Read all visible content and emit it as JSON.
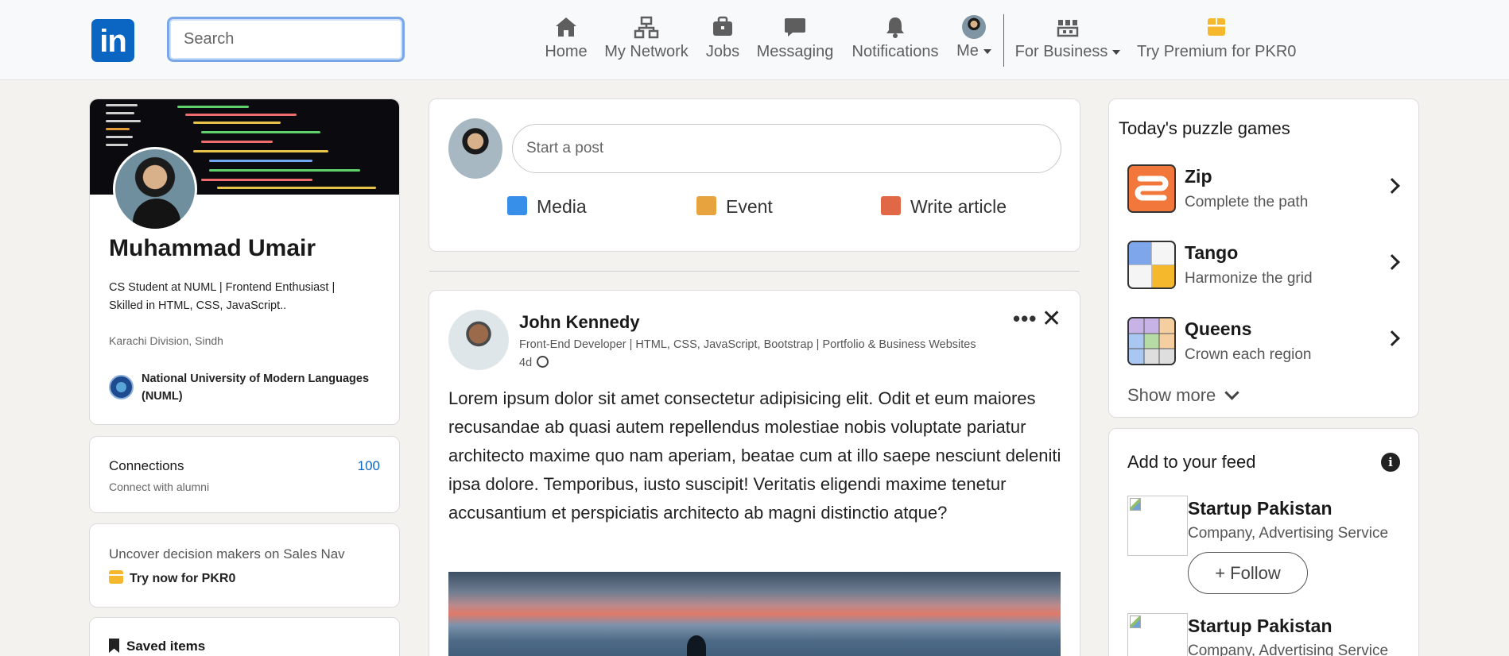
{
  "header": {
    "logo_text": "in",
    "search_placeholder": "Search",
    "nav": [
      {
        "label": "Home",
        "icon": "home-icon"
      },
      {
        "label": "My Network",
        "icon": "network-icon"
      },
      {
        "label": "Jobs",
        "icon": "briefcase-icon"
      },
      {
        "label": "Messaging",
        "icon": "message-icon"
      },
      {
        "label": "Notifications",
        "icon": "bell-icon"
      },
      {
        "label": "Me",
        "icon": "avatar-icon"
      },
      {
        "label": "For Business",
        "icon": "apps-grid-icon"
      },
      {
        "label": "Try Premium for PKR0",
        "icon": "premium-icon"
      }
    ]
  },
  "profile": {
    "name": "Muhammad Umair",
    "headline": "CS Student at NUML | Frontend Enthusiast | Skilled in HTML, CSS, JavaScript..",
    "location": "Karachi Division, Sindh",
    "university": "National University of Modern Languages (NUML)"
  },
  "connections": {
    "title": "Connections",
    "subtitle": "Connect with alumni",
    "count": "100"
  },
  "sales_nav": {
    "text": "Uncover decision makers on Sales Nav",
    "cta": "Try now for PKR0"
  },
  "saved": {
    "label": "Saved items"
  },
  "composer": {
    "placeholder": "Start a post",
    "actions": [
      {
        "label": "Media",
        "icon": "image-icon",
        "color": "#378fe9"
      },
      {
        "label": "Event",
        "icon": "calendar-icon",
        "color": "#e7a33e"
      },
      {
        "label": "Write article",
        "icon": "article-icon",
        "color": "#e06847"
      }
    ]
  },
  "post": {
    "author": "John Kennedy",
    "headline": "Front-End Developer | HTML, CSS, JavaScript, Bootstrap | Portfolio & Business Websites",
    "time": "4d",
    "more": "•••",
    "close": "✕",
    "body": "Lorem ipsum dolor sit amet consectetur adipisicing elit. Odit et eum maiores recusandae ab quasi autem repellendus molestiae nobis voluptate pariatur architecto maxime quo nam aperiam, beatae cum at illo saepe nesciunt deleniti ipsa dolore. Temporibus, iusto suscipit! Veritatis eligendi maxime tenetur accusantium et perspiciatis architecto ab magni distinctio atque?"
  },
  "puzzles": {
    "title": "Today's puzzle games",
    "games": [
      {
        "name": "Zip",
        "subtitle": "Complete the path"
      },
      {
        "name": "Tango",
        "subtitle": "Harmonize the grid"
      },
      {
        "name": "Queens",
        "subtitle": "Crown each region"
      }
    ],
    "show_more": "Show more"
  },
  "feed_suggestions": {
    "title": "Add to your feed",
    "info": "i",
    "items": [
      {
        "name": "Startup Pakistan",
        "subtitle": "Company, Advertising Service",
        "follow": "+ Follow"
      },
      {
        "name": "Startup Pakistan",
        "subtitle": "Company, Advertising Service"
      }
    ]
  }
}
